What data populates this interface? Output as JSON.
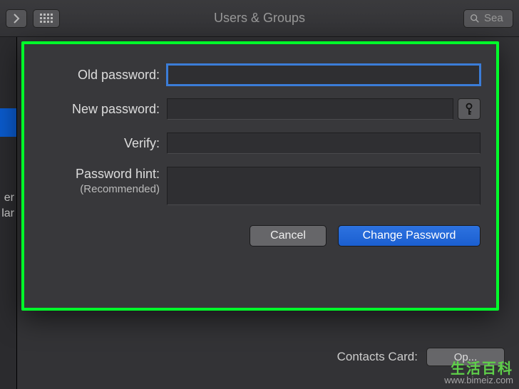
{
  "toolbar": {
    "title": "Users & Groups",
    "search_placeholder": "Sea"
  },
  "sidebar": {
    "partial_text_1": "er",
    "partial_text_2": "lar"
  },
  "main": {
    "contacts_label": "Contacts Card:",
    "open_label": "Op..."
  },
  "modal": {
    "old_password_label": "Old password:",
    "new_password_label": "New password:",
    "verify_label": "Verify:",
    "hint_label": "Password hint:",
    "hint_sub": "(Recommended)",
    "old_password_value": "",
    "new_password_value": "",
    "verify_value": "",
    "hint_value": "",
    "cancel_label": "Cancel",
    "change_label": "Change Password"
  },
  "watermark": {
    "line1": "生活百科",
    "line2": "www.bimeiz.com"
  }
}
